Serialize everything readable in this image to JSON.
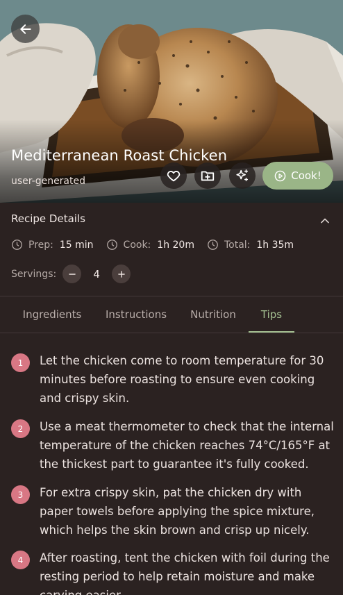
{
  "recipe": {
    "title": "Mediterranean Roast Chicken",
    "source": "user-generated"
  },
  "actions": {
    "back_icon": "arrow-left-icon",
    "favorite_icon": "heart-icon",
    "collection_icon": "folder-plus-icon",
    "ai_icon": "sparkles-icon",
    "cook_label": "Cook!",
    "cook_icon": "play-circle-icon"
  },
  "details": {
    "title": "Recipe Details",
    "collapse_icon": "chevron-up-icon",
    "prep_label": "Prep:",
    "prep_value": "15 min",
    "cook_label": "Cook:",
    "cook_value": "1h 20m",
    "total_label": "Total:",
    "total_value": "1h 35m",
    "servings_label": "Servings:",
    "servings_value": "4"
  },
  "tabs": [
    {
      "label": "Ingredients",
      "active": false
    },
    {
      "label": "Instructions",
      "active": false
    },
    {
      "label": "Nutrition",
      "active": false
    },
    {
      "label": "Tips",
      "active": true
    }
  ],
  "tips": [
    {
      "number": "1",
      "text": "Let the chicken come to room temperature for 30 minutes before roasting to ensure even cooking and crispy skin."
    },
    {
      "number": "2",
      "text": "Use a meat thermometer to check that the internal temperature of the chicken reaches 74°C/165°F at the thickest part to guarantee it's fully cooked."
    },
    {
      "number": "3",
      "text": "For extra crispy skin, pat the chicken dry with paper towels before applying the spice mixture, which helps the skin brown and crisp up nicely."
    },
    {
      "number": "4",
      "text": "After roasting, tent the chicken with foil during the resting period to help retain moisture and make carving easier."
    }
  ],
  "colors": {
    "accent_green": "#9ab587",
    "tab_active": "#a4bf91",
    "badge_pink": "#d87784",
    "background": "#2b2221"
  }
}
